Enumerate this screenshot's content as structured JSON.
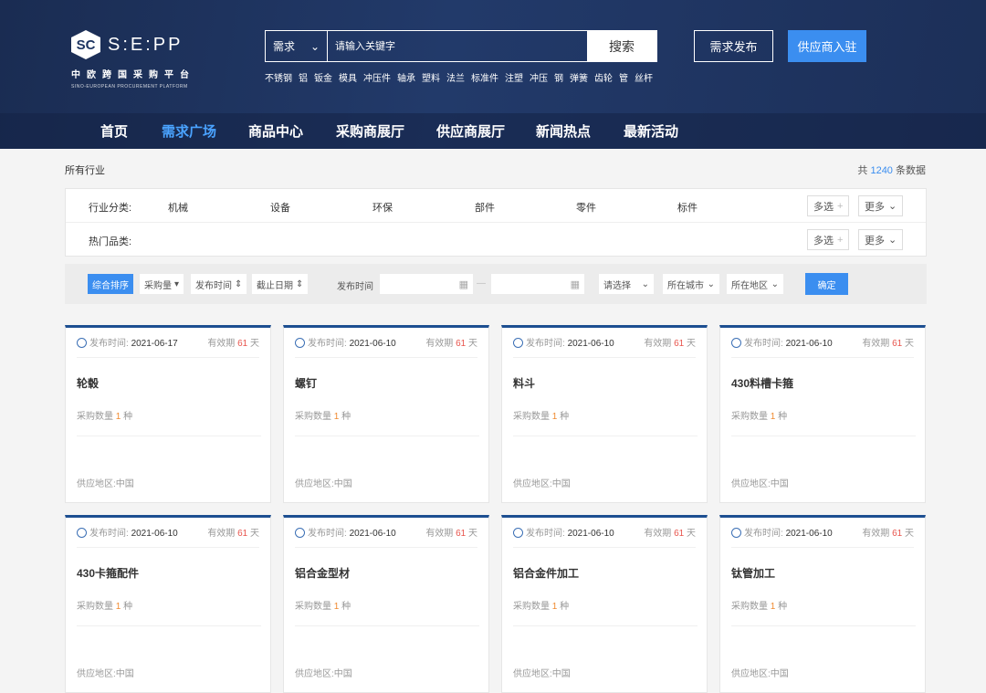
{
  "logo": {
    "badge": "SC",
    "name": "S:E:PP",
    "cn": "中欧跨国采购平台",
    "en": "SINO-EUROPEAN PROCUREMENT PLATFORM"
  },
  "search": {
    "type": "需求",
    "placeholder": "请输入关键字",
    "button": "搜索"
  },
  "hot_words": [
    "不锈钢",
    "铝",
    "钣金",
    "模具",
    "冲压件",
    "轴承",
    "塑料",
    "法兰",
    "标准件",
    "注塑",
    "冲压",
    "钢",
    "弹簧",
    "齿轮",
    "管",
    "丝杆"
  ],
  "header_buttons": {
    "publish": "需求发布",
    "join": "供应商入驻"
  },
  "nav": [
    "首页",
    "需求广场",
    "商品中心",
    "采购商展厅",
    "供应商展厅",
    "新闻热点",
    "最新活动"
  ],
  "crumb": "所有行业",
  "total": {
    "prefix": "共",
    "count": "1240",
    "suffix": "条数据"
  },
  "filter": {
    "industry_label": "行业分类:",
    "industries": [
      "机械",
      "设备",
      "环保",
      "部件",
      "零件",
      "标件"
    ],
    "hot_label": "热门品类:",
    "multi": "多选",
    "more": "更多"
  },
  "sortbar": {
    "sorts": [
      "综合排序",
      "采购量",
      "发布时间",
      "截止日期"
    ],
    "time_label": "发布时间",
    "dash": "—",
    "select": "请选择",
    "city": "所在城市",
    "region": "所在地区",
    "confirm": "确定"
  },
  "card_labels": {
    "published": "发布时间:",
    "valid": "有效期",
    "days": "天",
    "qty": "采购数量",
    "unit": "种",
    "area": "供应地区:"
  },
  "cards": [
    {
      "date": "2021-06-17",
      "valid": "61",
      "title": "轮毂",
      "qty": "1",
      "area": "中国"
    },
    {
      "date": "2021-06-10",
      "valid": "61",
      "title": "螺钉",
      "qty": "1",
      "area": "中国"
    },
    {
      "date": "2021-06-10",
      "valid": "61",
      "title": "料斗",
      "qty": "1",
      "area": "中国"
    },
    {
      "date": "2021-06-10",
      "valid": "61",
      "title": "430料槽卡箍",
      "qty": "1",
      "area": "中国"
    },
    {
      "date": "2021-06-10",
      "valid": "61",
      "title": "430卡箍配件",
      "qty": "1",
      "area": "中国"
    },
    {
      "date": "2021-06-10",
      "valid": "61",
      "title": "铝合金型材",
      "qty": "1",
      "area": "中国"
    },
    {
      "date": "2021-06-10",
      "valid": "61",
      "title": "铝合金件加工",
      "qty": "1",
      "area": "中国"
    },
    {
      "date": "2021-06-10",
      "valid": "61",
      "title": "钛管加工",
      "qty": "1",
      "area": "中国"
    }
  ]
}
